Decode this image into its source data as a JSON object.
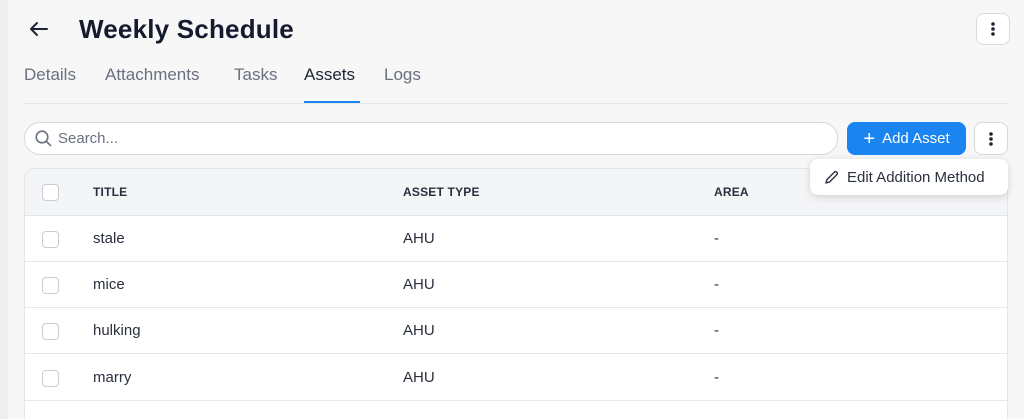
{
  "header": {
    "title": "Weekly Schedule"
  },
  "tabs": [
    {
      "label": "Details"
    },
    {
      "label": "Attachments"
    },
    {
      "label": "Tasks"
    },
    {
      "label": "Assets",
      "active": true
    },
    {
      "label": "Logs"
    }
  ],
  "toolbar": {
    "search_placeholder": "Search...",
    "add_label": "Add Asset"
  },
  "menu": {
    "edit_addition_label": "Edit Addition Method"
  },
  "table": {
    "columns": [
      "TITLE",
      "ASSET TYPE",
      "AREA"
    ],
    "rows": [
      {
        "title": "stale",
        "asset_type": "AHU",
        "area": "-"
      },
      {
        "title": "mice",
        "asset_type": "AHU",
        "area": "-"
      },
      {
        "title": "hulking",
        "asset_type": "AHU",
        "area": "-"
      },
      {
        "title": "marry",
        "asset_type": "AHU",
        "area": "-"
      }
    ]
  },
  "colors": {
    "accent": "#1a84f0",
    "title": "#151a2d"
  },
  "icons": [
    "back-arrow-icon",
    "kebab-icon",
    "search-icon",
    "plus-icon",
    "pencil-icon"
  ]
}
